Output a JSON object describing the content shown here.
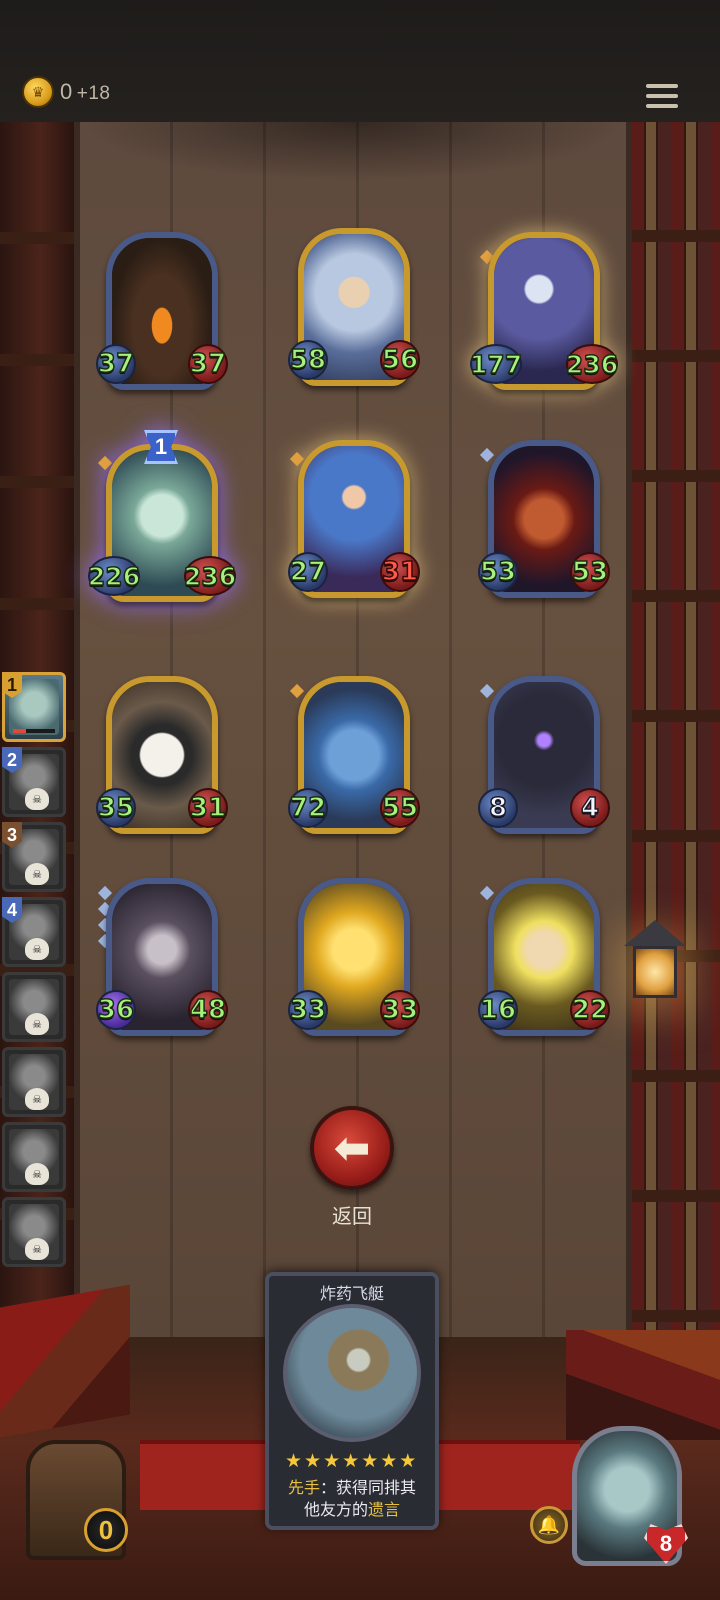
{
  "topbar": {
    "gold_value": "0",
    "gold_delta": "+18",
    "icons": {
      "gold": "crown-coin-icon",
      "menu": "hamburger-menu-icon"
    }
  },
  "board": {
    "minions": [
      {
        "id": "minion-treant",
        "art": "tree",
        "attack": "37",
        "health": "37",
        "frame": "blue"
      },
      {
        "id": "minion-dwarf-king",
        "art": "king",
        "attack": "58",
        "health": "56",
        "frame": "gold"
      },
      {
        "id": "minion-dark-ranger",
        "art": "elf",
        "attack": "177",
        "health": "236",
        "frame": "gold"
      },
      {
        "id": "minion-spectral-goat",
        "art": "goat",
        "attack": "226",
        "health": "236",
        "frame": "gold",
        "level_badge": "1"
      },
      {
        "id": "minion-sorceress",
        "art": "sorc",
        "attack": "27",
        "health": "31",
        "frame": "gold"
      },
      {
        "id": "minion-red-drake",
        "art": "drake",
        "attack": "53",
        "health": "53",
        "frame": "blue"
      },
      {
        "id": "minion-patchwork-cow",
        "art": "cow",
        "attack": "35",
        "health": "31",
        "frame": "gold"
      },
      {
        "id": "minion-blue-dragon",
        "art": "dragon",
        "attack": "72",
        "health": "55",
        "frame": "gold"
      },
      {
        "id": "minion-hooded-cultist",
        "art": "hood",
        "attack": "8",
        "health": "4",
        "frame": "blue"
      },
      {
        "id": "minion-dark-wyrm",
        "art": "grey",
        "attack": "36",
        "health": "48",
        "frame": "blue"
      },
      {
        "id": "minion-golden-dragon",
        "art": "golden",
        "attack": "33",
        "health": "33",
        "frame": "blue"
      },
      {
        "id": "minion-horned-demon",
        "art": "demon",
        "attack": "16",
        "health": "22",
        "frame": "blue"
      }
    ]
  },
  "roster": {
    "items": [
      {
        "rank": "1",
        "active": true
      },
      {
        "rank": "2"
      },
      {
        "rank": "3"
      },
      {
        "rank": "4"
      },
      {
        "rank": ""
      },
      {
        "rank": ""
      },
      {
        "rank": ""
      },
      {
        "rank": ""
      }
    ]
  },
  "back": {
    "label": "返回",
    "icon": "arrow-left-icon"
  },
  "spell_card": {
    "title": "炸药飞艇",
    "stars": 7,
    "desc_keyword_1": "先手",
    "desc_part_1": "：获得同排其",
    "desc_part_2": "他友方的",
    "desc_keyword_2": "遗言"
  },
  "chest": {
    "count": "0"
  },
  "hero": {
    "health": "8",
    "power_icon": "bell-icon"
  },
  "colors": {
    "attack_text": "#a6f27e",
    "damaged_text": "#ff5a4a",
    "gold_frame": "#c89a2e",
    "blue_frame": "#4a5a88",
    "back_button": "#b82a22"
  }
}
